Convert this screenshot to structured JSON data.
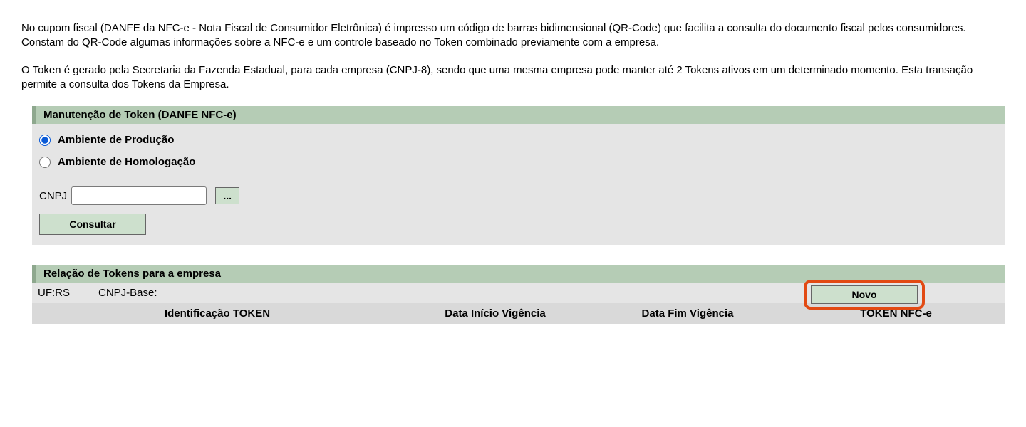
{
  "intro": {
    "p1": "No cupom fiscal (DANFE da NFC-e - Nota Fiscal de Consumidor Eletrônica) é impresso um código de barras bidimensional (QR-Code) que facilita a consulta do documento fiscal pelos consumidores. Constam do QR-Code algumas informações sobre a NFC-e e um controle baseado no Token combinado previamente com a empresa.",
    "p2": "O Token é gerado pela Secretaria da Fazenda Estadual, para cada empresa (CNPJ-8), sendo que uma mesma empresa pode manter até 2 Tokens ativos em um determinado momento. Esta transação permite a consulta dos Tokens da Empresa."
  },
  "panel1": {
    "title": "Manutenção de Token (DANFE NFC-e)",
    "radios": {
      "prod": "Ambiente de Produção",
      "homolog": "Ambiente de Homologação"
    },
    "cnpj_label": "CNPJ",
    "cnpj_value": "",
    "ellipsis_label": "...",
    "consultar_label": "Consultar"
  },
  "panel2": {
    "title": "Relação de Tokens para a empresa",
    "uf_label": "UF:",
    "uf_value": "RS",
    "cnpjbase_label": "CNPJ-Base:",
    "cnpjbase_value": "",
    "novo_label": "Novo",
    "columns": {
      "c1": "Identificação TOKEN",
      "c2": "Data Início Vigência",
      "c3": "Data Fim Vigência",
      "c4": "TOKEN NFC-e"
    }
  }
}
